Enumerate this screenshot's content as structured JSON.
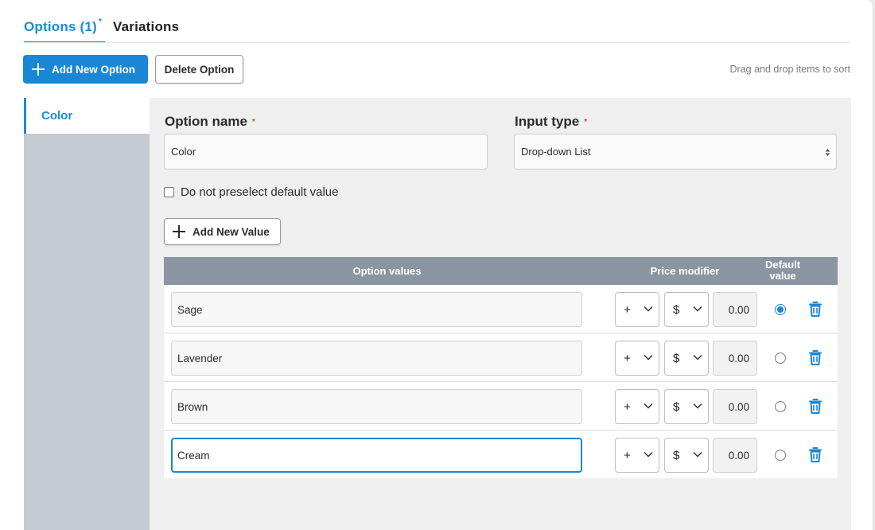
{
  "tabs": {
    "options_label": "Options (1)",
    "options_marker": "*",
    "variations_label": "Variations"
  },
  "toolbar": {
    "add_option_label": "Add New Option",
    "delete_option_label": "Delete Option",
    "hint": "Drag and drop items to sort"
  },
  "sidebar": {
    "items": [
      {
        "label": "Color",
        "active": true
      }
    ]
  },
  "form": {
    "option_name_label": "Option name",
    "option_name_value": "Color",
    "input_type_label": "Input type",
    "input_type_value": "Drop-down List",
    "required_marker": "*",
    "preselect_label": "Do not preselect default value",
    "preselect_checked": false,
    "add_value_label": "Add New Value"
  },
  "table": {
    "headers": {
      "values": "Option values",
      "price": "Price modifier",
      "default_line1": "Default",
      "default_line2": "value"
    },
    "rows": [
      {
        "value": "Sage",
        "sign": "+",
        "unit": "$",
        "amount": "0.00",
        "default": true,
        "focused": false
      },
      {
        "value": "Lavender",
        "sign": "+",
        "unit": "$",
        "amount": "0.00",
        "default": false,
        "focused": false
      },
      {
        "value": "Brown",
        "sign": "+",
        "unit": "$",
        "amount": "0.00",
        "default": false,
        "focused": false
      },
      {
        "value": "Cream",
        "sign": "+",
        "unit": "$",
        "amount": "0.00",
        "default": false,
        "focused": true
      }
    ]
  },
  "colors": {
    "accent": "#1a86d6",
    "header_bg": "#8b95a1",
    "sidebar_bg": "#c5cad3",
    "required": "#d8413e"
  },
  "icons": {
    "add": "plus-icon",
    "delete_row": "trash-icon",
    "select_caret": "chevron-down-icon",
    "select_sort": "sort-arrows-icon"
  }
}
